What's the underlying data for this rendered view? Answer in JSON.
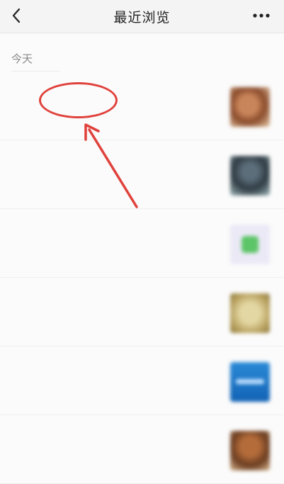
{
  "nav": {
    "back_icon": "chevron-left-icon",
    "title": "最近浏览",
    "more_icon": "more-horizontal-icon"
  },
  "section": {
    "label": "今天"
  },
  "feed": {
    "items": [
      {
        "title": "",
        "meta": "",
        "thumb_color": "#a5643f"
      },
      {
        "title": "",
        "meta": "",
        "thumb_color": "#3f4c55"
      },
      {
        "title": "",
        "meta": "",
        "thumb_color": "#ebe9f6"
      },
      {
        "title": "",
        "meta": "",
        "thumb_color": "#c9b474"
      },
      {
        "title": "",
        "meta": "",
        "thumb_color": "#1f77c9"
      },
      {
        "title": "",
        "meta": "",
        "thumb_color": "#8a5030"
      }
    ]
  },
  "annotation": {
    "color": "#e0413b"
  }
}
